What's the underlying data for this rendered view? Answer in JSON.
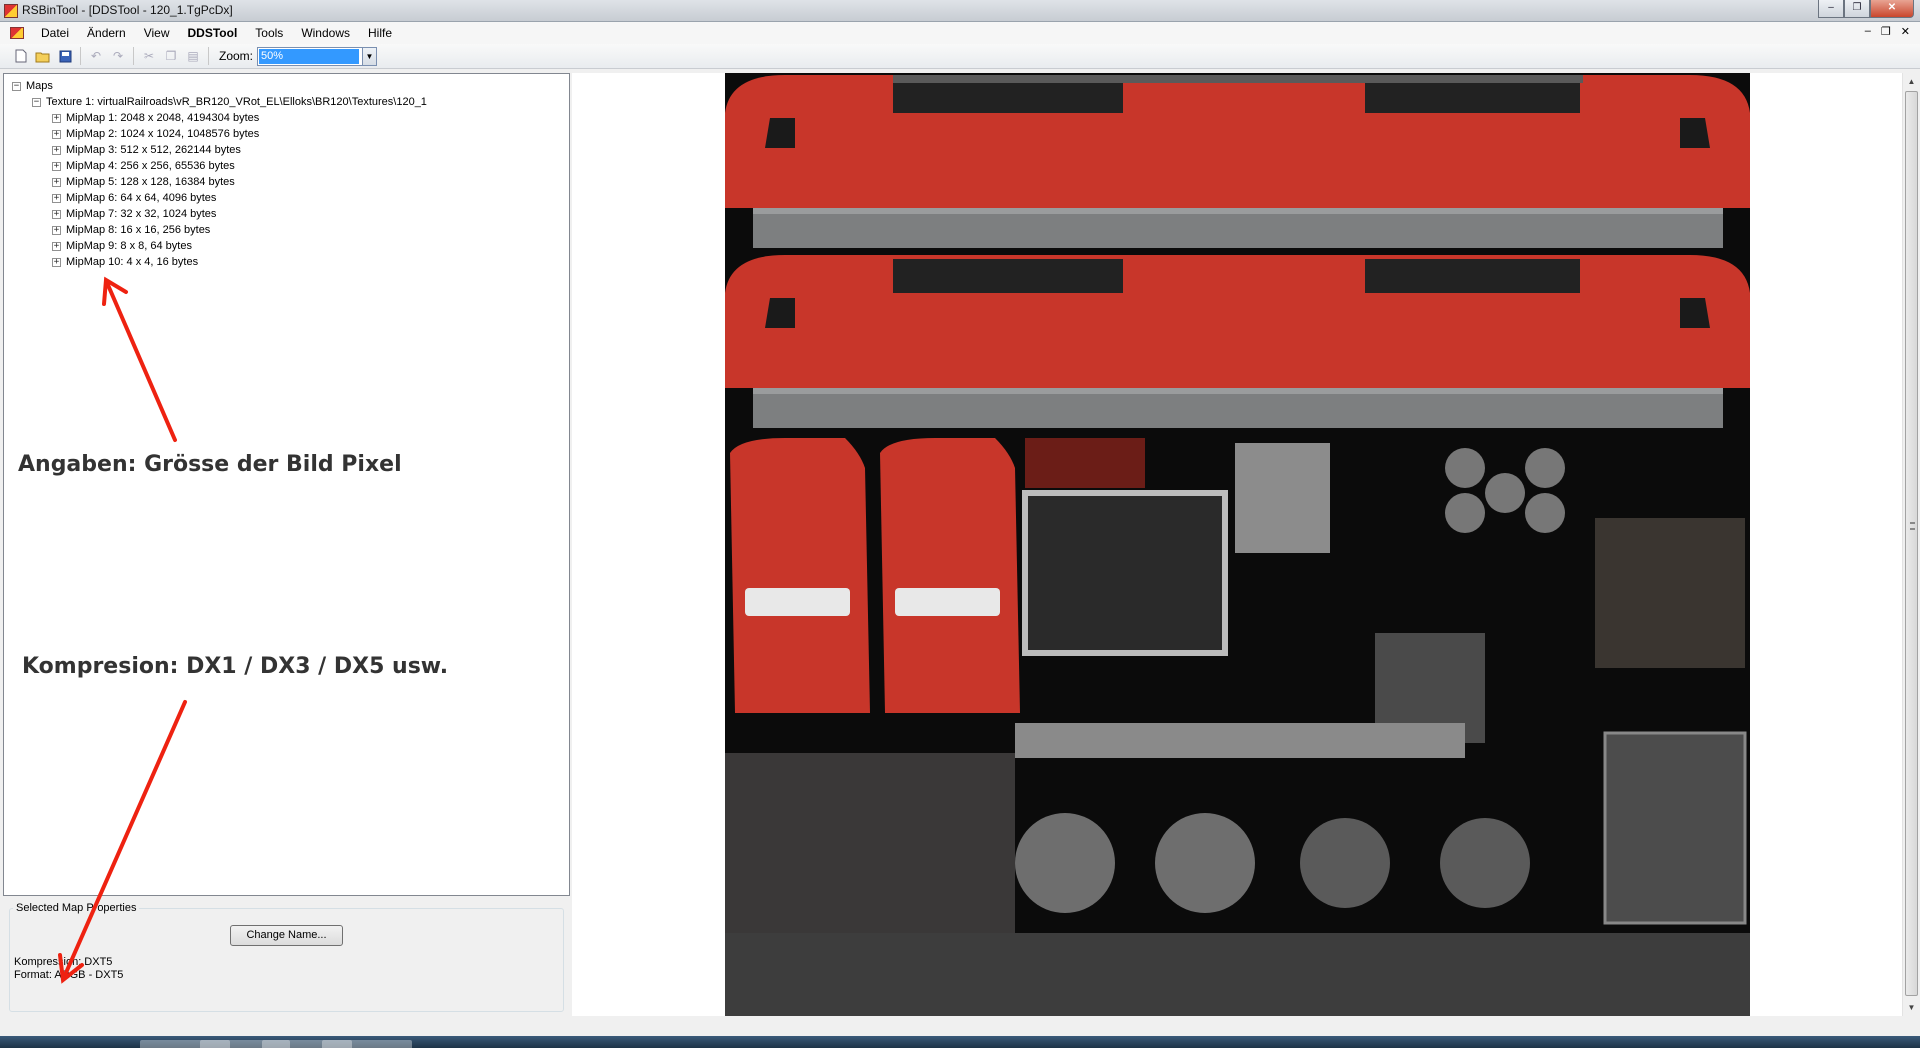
{
  "window": {
    "title": "RSBinTool - [DDSTool - 120_1.TgPcDx]",
    "controls": [
      "–",
      "❐",
      "✕"
    ]
  },
  "menu": {
    "items": [
      {
        "label": "Datei",
        "bold": false
      },
      {
        "label": "Ändern",
        "bold": false
      },
      {
        "label": "View",
        "bold": false
      },
      {
        "label": "DDSTool",
        "bold": true
      },
      {
        "label": "Tools",
        "bold": false
      },
      {
        "label": "Windows",
        "bold": false
      },
      {
        "label": "Hilfe",
        "bold": false
      }
    ],
    "mdi_controls": [
      "–",
      "❐",
      "✕"
    ]
  },
  "toolbar": {
    "zoom_label": "Zoom:",
    "zoom_value": "50%",
    "icons": [
      "new-file-icon",
      "open-folder-icon",
      "save-icon",
      "undo-icon",
      "redo-icon",
      "cut-icon",
      "copy-icon",
      "paste-icon"
    ]
  },
  "tree": {
    "root": "Maps",
    "texture": "Texture 1: virtualRailroads\\vR_BR120_VRot_EL\\Elloks\\BR120\\Textures\\120_1",
    "mipmaps": [
      "MipMap 1: 2048 x 2048, 4194304 bytes",
      "MipMap 2: 1024 x 1024, 1048576 bytes",
      "MipMap 3: 512 x 512, 262144 bytes",
      "MipMap 4: 256 x 256, 65536 bytes",
      "MipMap 5: 128 x 128, 16384 bytes",
      "MipMap 6: 64 x 64, 4096 bytes",
      "MipMap 7: 32 x 32, 1024 bytes",
      "MipMap 8: 16 x 16, 256 bytes",
      "MipMap 9: 8 x 8, 64 bytes",
      "MipMap 10: 4 x 4, 16 bytes"
    ]
  },
  "annotations": {
    "pixel_size": "Angaben: Grösse der Bild Pixel",
    "compression": "Kompresion: DX1 / DX3 / DX5 usw."
  },
  "properties": {
    "legend": "Selected Map Properties",
    "change_name_button": "Change Name...",
    "compression": "Kompression: DXT5",
    "format": "Format: ARGB - DXT5"
  },
  "colors": {
    "annotation_arrow": "#ee2211",
    "loco_red": "#c8362a"
  }
}
